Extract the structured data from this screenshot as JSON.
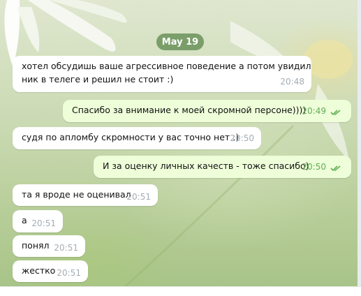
{
  "date_badge": "May 19",
  "messages": [
    {
      "text_line1": "хотел обсудишь ваше агрессивное поведение а потом увидил",
      "text_line2": "ник в телеге и решил не стоит :)",
      "time": "20:48",
      "direction": "incoming"
    },
    {
      "text": "Спасибо за внимание к моей скромной персоне))))",
      "time": "20:49",
      "direction": "outgoing",
      "status": "read"
    },
    {
      "text": "судя по апломбу скромности у вас точно нет :)",
      "time": "20:50",
      "direction": "incoming"
    },
    {
      "text": "И за оценку личных качеств - тоже спасибо)",
      "time": "20:50",
      "direction": "outgoing",
      "status": "read"
    },
    {
      "text": "та я вроде не оценивал",
      "time": "20:51",
      "direction": "incoming"
    },
    {
      "text": "а",
      "time": "20:51",
      "direction": "incoming"
    },
    {
      "text": "понял",
      "time": "20:51",
      "direction": "incoming"
    },
    {
      "text": "жестко",
      "time": "20:51",
      "direction": "incoming"
    }
  ],
  "colors": {
    "incoming_bubble": "#ffffff",
    "outgoing_bubble": "#eefed9",
    "outgoing_time": "#62ac55",
    "read_ticks": "#5fb04f",
    "date_badge_bg": "#608a50"
  },
  "icons": {
    "read_status": "double-check-icon"
  }
}
